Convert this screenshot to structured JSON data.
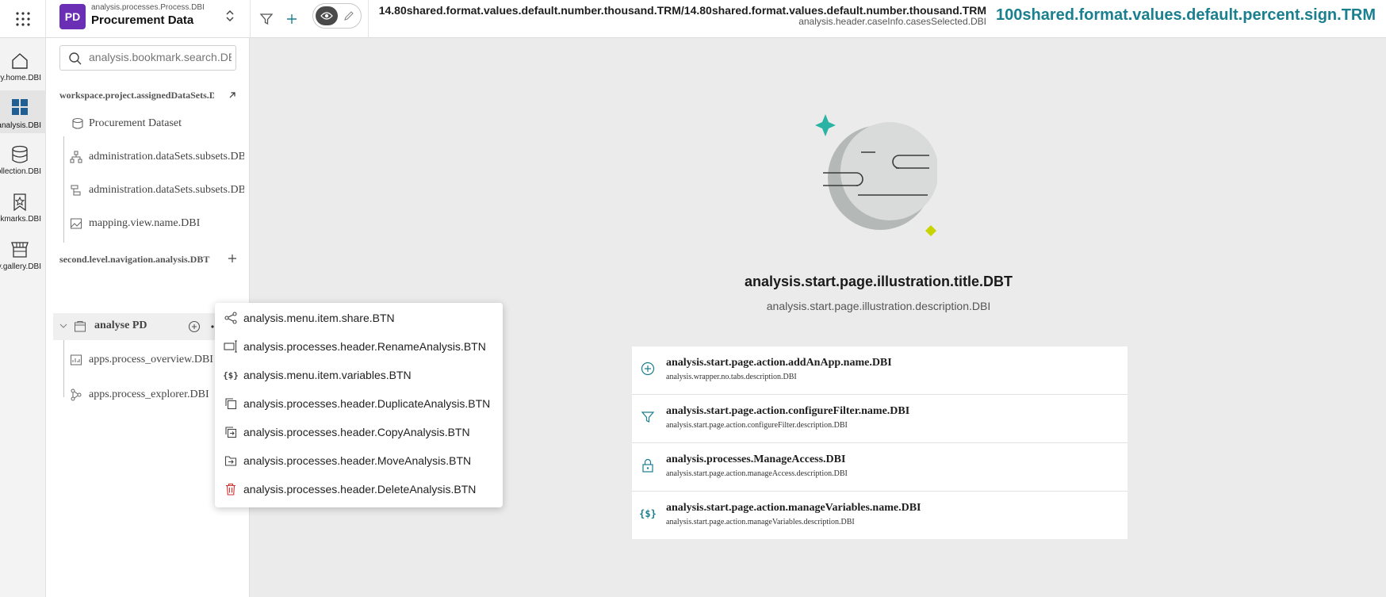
{
  "header": {
    "process_sub": "analysis.processes.Process.DBI",
    "process_title": "Procurement Data",
    "process_badge": "PD",
    "cases_count": "14.80shared.format.values.default.number.thousand.TRM/14.80shared.format.values.default.number.thousand.TRM",
    "cases_label": "analysis.header.caseInfo.casesSelected.DBI",
    "cases_percent": "100shared.format.values.default.percent.sign.TRM"
  },
  "rail": {
    "items": [
      {
        "label": "ation.entry.home.DBI",
        "icon": "home-icon"
      },
      {
        "label": "ation.entry.analysis.DBI",
        "icon": "dashboard-icon"
      },
      {
        "label": "n.entry.dataCollection.DBI",
        "icon": "database-icon"
      },
      {
        "label": "ion.entry.bookmarks.DBI",
        "icon": "bookmark-star-icon"
      },
      {
        "label": "ation.entry.gallery.DBI",
        "icon": "gallery-icon"
      }
    ]
  },
  "nav": {
    "search_placeholder": "analysis.bookmark.search.DBI",
    "datasets_header": "workspace.project.assignedDataSets.DBT",
    "dataset": "Procurement Dataset",
    "dataset_children": [
      "administration.dataSets.subsets.DBI",
      "administration.dataSets.subsets.DBI",
      "mapping.view.name.DBI"
    ],
    "analysis_header": "second.level.navigation.analysis.DBT",
    "analysis_name": "analyse PD",
    "analysis_children": [
      "apps.process_overview.DBI",
      "apps.process_explorer.DBI"
    ]
  },
  "menu": {
    "items": [
      {
        "label": "analysis.menu.item.share.BTN",
        "icon": "share-icon"
      },
      {
        "label": "analysis.processes.header.RenameAnalysis.BTN",
        "icon": "rename-icon"
      },
      {
        "label": "analysis.menu.item.variables.BTN",
        "icon": "variables-icon"
      },
      {
        "label": "analysis.processes.header.DuplicateAnalysis.BTN",
        "icon": "duplicate-icon"
      },
      {
        "label": "analysis.processes.header.CopyAnalysis.BTN",
        "icon": "copy-icon"
      },
      {
        "label": "analysis.processes.header.MoveAnalysis.BTN",
        "icon": "move-icon"
      },
      {
        "label": "analysis.processes.header.DeleteAnalysis.BTN",
        "icon": "delete-icon"
      }
    ]
  },
  "main": {
    "title": "analysis.start.page.illustration.title.DBT",
    "description": "analysis.start.page.illustration.description.DBI",
    "actions": [
      {
        "name": "analysis.start.page.action.addAnApp.name.DBI",
        "description": "analysis.wrapper.no.tabs.description.DBI",
        "icon": "add-circle-icon"
      },
      {
        "name": "analysis.start.page.action.configureFilter.name.DBI",
        "description": "analysis.start.page.action.configureFilter.description.DBI",
        "icon": "filter-icon"
      },
      {
        "name": "analysis.processes.ManageAccess.DBI",
        "description": "analysis.start.page.action.manageAccess.description.DBI",
        "icon": "lock-icon"
      },
      {
        "name": "analysis.start.page.action.manageVariables.name.DBI",
        "description": "analysis.start.page.action.manageVariables.description.DBI",
        "icon": "variables-icon"
      }
    ]
  },
  "colors": {
    "accent_teal": "#1a7f8e",
    "badge_purple": "#6b2fb5",
    "rail_active": "#1f5f94",
    "delete_red": "#d32f2f",
    "lime": "#c8d400"
  }
}
